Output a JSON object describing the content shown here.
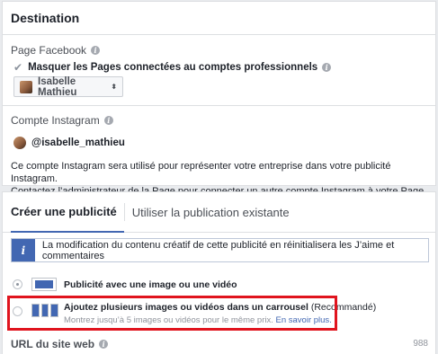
{
  "destination": {
    "title": "Destination",
    "facebook_page_label": "Page Facebook",
    "hide_pages_label": "Masquer les Pages connectées au comptes professionnels",
    "selected_page": "Isabelle Mathieu",
    "instagram_label": "Compte Instagram",
    "instagram_account": "@isabelle_mathieu",
    "instagram_desc_line1": "Ce compte Instagram sera utilisé pour représenter votre entreprise dans votre publicité Instagram.",
    "instagram_desc_line2": "Contactez l’administrateur de la Page pour connecter un autre compte Instagram à votre Page."
  },
  "create": {
    "tabs": [
      {
        "label": "Créer une publicité",
        "active": true
      },
      {
        "label": "Utiliser la publication existante",
        "active": false
      }
    ],
    "info_banner": "La modification du contenu créatif de cette publicité en réinitialisera les J’aime et commentaires",
    "options": [
      {
        "title": "Publicité avec une image ou une vidéo",
        "selected": true
      },
      {
        "title": "Ajoutez plusieurs images ou vidéos dans un carrousel",
        "title_suffix": "(Recommandé)",
        "subtitle": "Montrez jusqu’à 5 images ou vidéos pour le même prix.",
        "link": "En savoir plus.",
        "selected": false
      }
    ],
    "url_label": "URL du site web",
    "url_counter": "988"
  },
  "colors": {
    "accent": "#4267b2",
    "highlight": "#e0141e",
    "background": "#e9ebee"
  }
}
